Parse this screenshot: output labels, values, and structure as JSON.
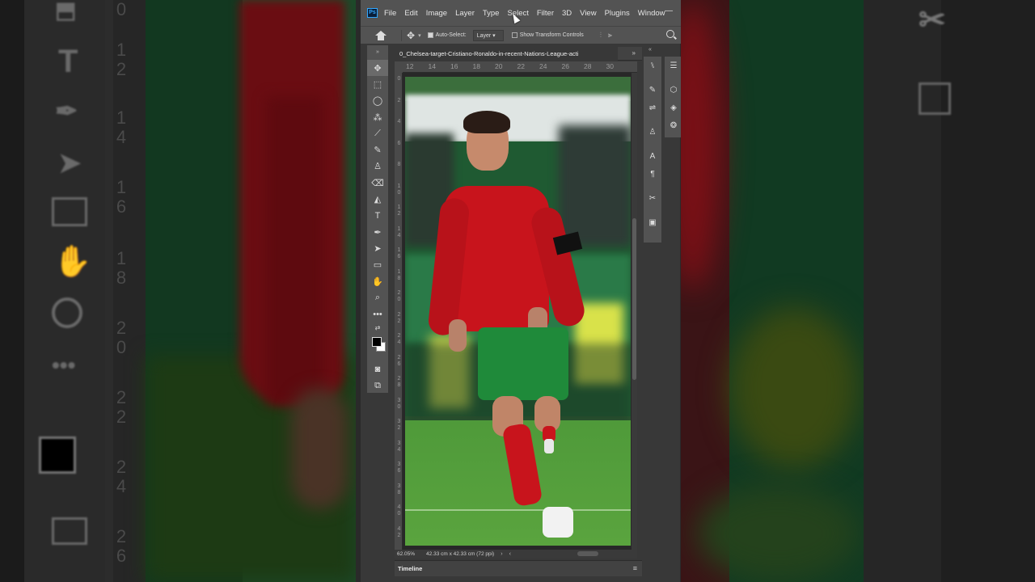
{
  "app": {
    "logo": "Ps",
    "menu": [
      "File",
      "Edit",
      "Image",
      "Layer",
      "Type",
      "Select",
      "Filter",
      "3D",
      "View",
      "Plugins",
      "Window"
    ]
  },
  "options_bar": {
    "auto_select_label": "Auto-Select:",
    "layer_select_value": "Layer",
    "show_transform_label": "Show Transform Controls"
  },
  "document": {
    "tab_title": "0_Chelsea-target-Cristiano-Ronaldo-in-recent-Nations-League-acti",
    "ruler_top": [
      "12",
      "14",
      "16",
      "18",
      "20",
      "22",
      "24",
      "26",
      "28",
      "30"
    ],
    "ruler_left": [
      "0",
      "2",
      "4",
      "6",
      "8",
      "1\n0",
      "1\n2",
      "1\n4",
      "1\n6",
      "1\n8",
      "2\n0",
      "2\n2",
      "2\n4",
      "2\n6",
      "2\n8",
      "3\n0",
      "3\n2",
      "3\n4",
      "3\n6",
      "3\n8",
      "4\n0",
      "4\n2"
    ],
    "zoom": "62.05%",
    "doc_size": "42.33 cm x 42.33 cm (72 ppi)"
  },
  "panels": {
    "timeline_label": "Timeline"
  },
  "colors": {
    "foreground": "#000000",
    "background": "#ffffff",
    "jersey_red": "#c8141c",
    "shorts_green": "#1f8a3a"
  },
  "tools": [
    "move-icon",
    "marquee-icon",
    "lasso-icon",
    "quick-select-icon",
    "eyedropper-icon",
    "brush-icon",
    "stamp-icon",
    "eraser-icon",
    "paint-bucket-icon",
    "type-icon",
    "pen-icon",
    "path-select-icon",
    "rectangle-icon",
    "hand-icon",
    "zoom-icon",
    "more-icon"
  ]
}
